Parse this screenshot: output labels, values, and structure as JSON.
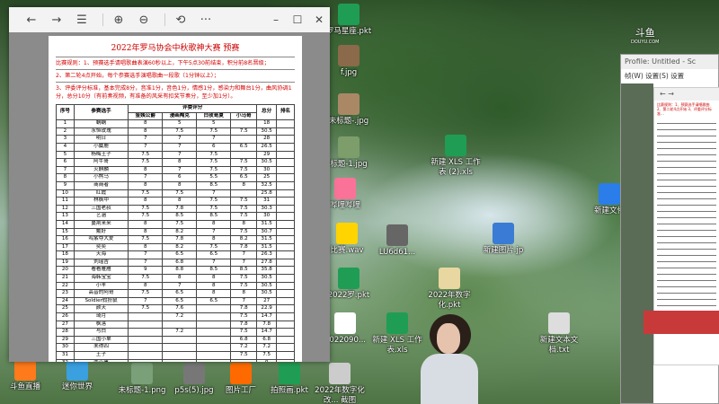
{
  "desktop": {
    "icons": [
      {
        "label": "斗鱼直播",
        "color": "#ff7a1a"
      },
      {
        "label": "迷你世界",
        "color": "#3aa0e0"
      },
      {
        "label": "罗马星座.pkt",
        "color": "#1f9d55"
      },
      {
        "label": "f.jpg",
        "color": "#8a6a4a"
      },
      {
        "label": "未标题-.jpg",
        "color": "#aa8866"
      },
      {
        "label": "标题-1.jpg",
        "color": "#7d9e6b"
      },
      {
        "label": "新建 XLS 工作表 (2).xls",
        "color": "#1f9d55"
      },
      {
        "label": "哔哩哔哩",
        "color": "#fb7299"
      },
      {
        "label": "新建文件",
        "color": "#2b7de9"
      },
      {
        "label": "比赛.wav",
        "color": "#ffd400"
      },
      {
        "label": "LU6d61...",
        "color": "#666666"
      },
      {
        "label": "新建图片.jp",
        "color": "#3a7bd5"
      },
      {
        "label": "2022罗.pkt",
        "color": "#1f9d55"
      },
      {
        "label": "2022年数字化.pkt",
        "color": "#e8d7a0"
      },
      {
        "label": "新建 XLS 工作表.xls",
        "color": "#1f9d55"
      },
      {
        "label": "新建文本文档.txt",
        "color": "#dddddd"
      },
      {
        "label": "2022090...",
        "color": "#ffffff"
      },
      {
        "label": "斗鱼直播",
        "color": "#ff7a1a"
      },
      {
        "label": "拍照...",
        "color": "#3aa0e0"
      },
      {
        "label": "未标题-1.png",
        "color": "#7aa07a"
      },
      {
        "label": "p5s(5).jpg",
        "color": "#777777"
      },
      {
        "label": "图片工厂",
        "color": "#ff6a00"
      },
      {
        "label": "拍照画.pkt",
        "color": "#1f9d55"
      },
      {
        "label": "2022年数字化改... 截图",
        "color": "#cccccc"
      },
      {
        "label": "新建文件夹",
        "color": "#2b7de9"
      }
    ],
    "douyu_logo": "斗鱼",
    "douyu_url": "DOUYU.COM"
  },
  "browser": {
    "toolbar": {
      "back": "←",
      "forward": "→",
      "view": "☰",
      "zoom_in": "⊕",
      "zoom_out": "⊖",
      "rotate": "⟲",
      "more": "···",
      "minimize": "–",
      "maximize": "☐",
      "close": "✕"
    },
    "document": {
      "title": "2022年罗马协会中秋歌神大赛 预赛",
      "rule1": "比赛规则：1、预赛选手请唱歌曲表演60秒以上，下午5点30前结束，积分前8名晋级；",
      "rule2": "2、第二轮4点开始，每个参赛选手演唱歌曲一段歌（1分钟以上）；",
      "rule3": "3、评委评分标准，基本完成8分，音准1分，音色1分，情感1分，感染力和舞台1分，曲风协调1分，总分10分（有前奏视频，有准备的风采有扣奖节奏分，至少加1分）。",
      "header": {
        "rank": "序号",
        "name": "参赛选手",
        "judges": "评委评分",
        "j1": "金姨公爵",
        "j2": "漫画陶克",
        "j3": "白夜哥夏",
        "j4": "小马哥",
        "total": "总分",
        "place": "排名"
      },
      "rows": [
        [
          "1",
          "蜗蜗",
          "8",
          "5",
          "5",
          "",
          "18"
        ],
        [
          "2",
          "永恒玫瑰",
          "8",
          "7.5",
          "7.5",
          "7.5",
          "30.5"
        ],
        [
          "3",
          "明日",
          "7",
          "7",
          "7",
          "",
          "28"
        ],
        [
          "4",
          "小麋鹿",
          "7",
          "7",
          "6",
          "6.5",
          "26.5"
        ],
        [
          "5",
          "杨梅王子",
          "7.5",
          "7",
          "7.5",
          "",
          "29"
        ],
        [
          "6",
          "阿牛哥",
          "7.5",
          "8",
          "7.5",
          "7.5",
          "30.5"
        ],
        [
          "7",
          "火麒麟",
          "8",
          "7",
          "7.5",
          "7.5",
          "30"
        ],
        [
          "8",
          "小熊马",
          "7",
          "6",
          "5.5",
          "6.5",
          "25"
        ],
        [
          "9",
          "商商者",
          "8",
          "8",
          "8.5",
          "8",
          "32.5"
        ],
        [
          "10",
          "红霞",
          "7.5",
          "7.5",
          "7",
          "",
          "25.8"
        ],
        [
          "11",
          "林枫中",
          "8",
          "8",
          "7.5",
          "7.5",
          "31"
        ],
        [
          "12",
          "三国老叔",
          "7.5",
          "7.8",
          "7.5",
          "7.5",
          "30.3"
        ],
        [
          "13",
          "艺涵",
          "7.5",
          "8.5",
          "8.5",
          "7.5",
          "30"
        ],
        [
          "14",
          "蔓荆来来",
          "8",
          "7.5",
          "8",
          "8",
          "31.5"
        ],
        [
          "15",
          "戴好",
          "8",
          "8.2",
          "7",
          "7.5",
          "30.7"
        ],
        [
          "16",
          "鸣紫夺大爱",
          "7.5",
          "7.8",
          "8",
          "8.2",
          "31.5"
        ],
        [
          "17",
          "奕奕",
          "8",
          "8.2",
          "7.5",
          "7.8",
          "31.5"
        ],
        [
          "18",
          "天海",
          "7",
          "6.5",
          "6.5",
          "7",
          "26.3"
        ],
        [
          "19",
          "刘瑶吉",
          "7",
          "6.8",
          "7",
          "7",
          "27.8"
        ],
        [
          "20",
          "看看雁雁",
          "9",
          "8.8",
          "8.5",
          "8.5",
          "35.8"
        ],
        [
          "21",
          "海韩宝宝",
          "7.5",
          "8",
          "8",
          "7.5",
          "30.5"
        ],
        [
          "22",
          "小羊",
          "8",
          "7",
          "8",
          "7.5",
          "30.5"
        ],
        [
          "23",
          "高音的阿哥",
          "7.5",
          "6.5",
          "8",
          "8",
          "30.5"
        ],
        [
          "24",
          "Soldier假扮鼠",
          "7",
          "6.5",
          "6.5",
          "7",
          "27"
        ],
        [
          "25",
          "颜天",
          "7.5",
          "7.6",
          "",
          "7.8",
          "22.9"
        ],
        [
          "26",
          "琦月",
          "",
          "7.2",
          "",
          "7.5",
          "14.7"
        ],
        [
          "27",
          "枫落",
          "",
          "",
          "",
          "7.8",
          "7.8"
        ],
        [
          "28",
          "与白",
          "",
          "7.2",
          "",
          "7.5",
          "14.7"
        ],
        [
          "29",
          "三国小单",
          "",
          "",
          "",
          "6.8",
          "6.8"
        ],
        [
          "30",
          "未得四",
          "",
          "",
          "",
          "7.2",
          "7.2"
        ],
        [
          "31",
          "王子",
          "",
          "",
          "",
          "7.5",
          "7.5"
        ],
        [
          "32",
          "西小黑",
          "",
          "",
          "",
          "",
          "0"
        ],
        [
          "33",
          "",
          "",
          "",
          "",
          "",
          "0"
        ]
      ]
    }
  },
  "right_window": {
    "title": "Profile: Untitled - Sc",
    "menu": "帧(W)  设置(S)  设置",
    "inner_bar": "← →",
    "mini_rules": "比赛规则：1、预赛选手请唱歌曲 2、第二轮4点开始 3、评委评分标准..."
  }
}
